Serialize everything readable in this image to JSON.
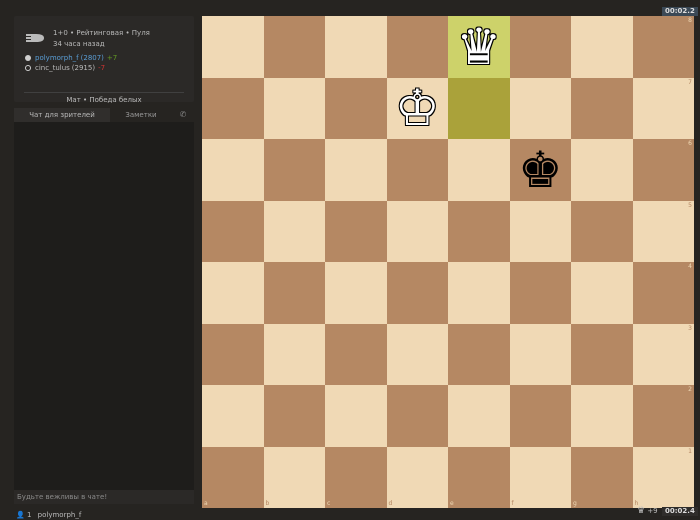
{
  "game": {
    "speed_line": "1+0 • Рейтинговая • Пуля",
    "time_ago": "34 часа назад",
    "icon": "bullet-icon",
    "players": [
      {
        "name": "polymorph_f",
        "rating": "(2807)",
        "diff": "+7",
        "color": "white"
      },
      {
        "name": "cinc_tulus",
        "rating": "(2915)",
        "diff": "-7",
        "color": "black"
      }
    ],
    "result": "Мат • Победа белых"
  },
  "chat": {
    "tab_spectators": "Чат для зрителей",
    "tab_notes": "Заметки",
    "phone_icon": "phone-icon",
    "input_placeholder": "Будьте вежливы в чате!"
  },
  "board": {
    "files": [
      "a",
      "b",
      "c",
      "d",
      "e",
      "f",
      "g",
      "h"
    ],
    "ranks": [
      "8",
      "7",
      "6",
      "5",
      "4",
      "3",
      "2",
      "1"
    ],
    "pieces": [
      {
        "square": "e8",
        "glyph": "♛",
        "color": "w",
        "name": "white-queen"
      },
      {
        "square": "d7",
        "glyph": "♔",
        "color": "w",
        "name": "white-king"
      },
      {
        "square": "f6",
        "glyph": "♚",
        "color": "b",
        "name": "black-king"
      }
    ],
    "last_move": [
      "e8",
      "e7"
    ],
    "light_color": "#f0d9b5",
    "dark_color": "#b58863"
  },
  "clocks": {
    "top": "00:02.2",
    "bottom": "00:02.4"
  },
  "material": {
    "glyph": "♛",
    "diff": "+9"
  },
  "footer": {
    "spectators": "1",
    "user": "polymorph_f"
  }
}
